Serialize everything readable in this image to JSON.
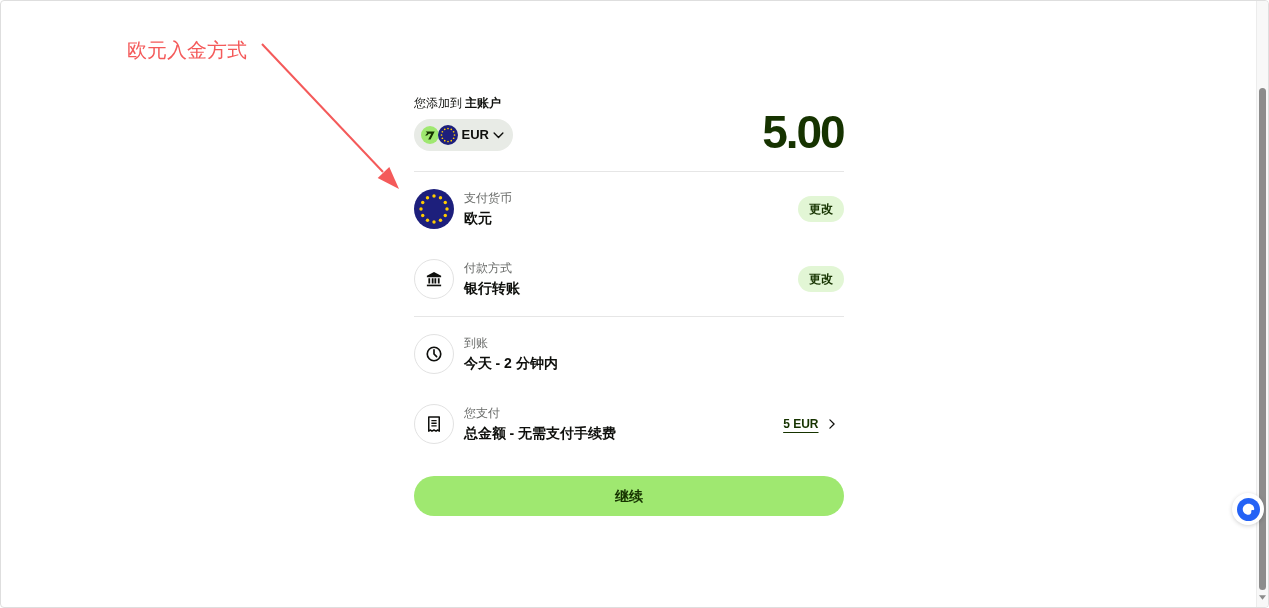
{
  "annotation": {
    "text": "欧元入金方式"
  },
  "header": {
    "text": "您添加到 **主账户**",
    "currency": "EUR",
    "amount": "5.00"
  },
  "groups": [
    {
      "rows": [
        {
          "kind": "currency",
          "label": "支付货币",
          "value": "欧元",
          "action": "更改"
        },
        {
          "kind": "method",
          "label": "付款方式",
          "value": "银行转账",
          "action": "更改"
        }
      ]
    },
    {
      "rows": [
        {
          "kind": "arrival",
          "label": "到账",
          "value": "今天 - 2 分钟内"
        },
        {
          "kind": "total",
          "label": "您支付",
          "value": "总金额 - 无需支付手续费",
          "link": "5 EUR"
        }
      ]
    }
  ],
  "continue_button": "继续"
}
